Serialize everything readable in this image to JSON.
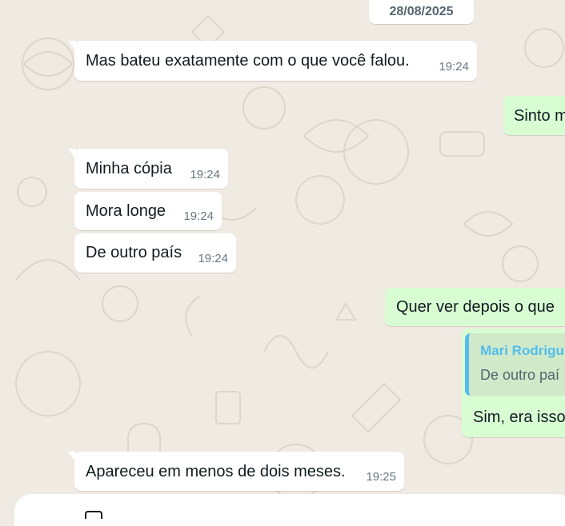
{
  "chat": {
    "date": "28/08/2025",
    "messages": [
      {
        "direction": "in",
        "text": "Mas bateu exatamente com o que você falou.",
        "time": "19:24"
      },
      {
        "direction": "out",
        "text": "Sinto m"
      },
      {
        "direction": "in",
        "text": "Minha cópia",
        "time": "19:24"
      },
      {
        "direction": "in",
        "text": "Mora longe",
        "time": "19:24"
      },
      {
        "direction": "in",
        "text": "De outro país",
        "time": "19:24"
      },
      {
        "direction": "out",
        "text": "Quer ver depois o que"
      },
      {
        "direction": "out",
        "quote_author": "Mari Rodrigu",
        "quote_text": "De outro paí",
        "text": "Sim, era isso"
      },
      {
        "direction": "in",
        "text": "Apareceu em menos de dois meses.",
        "time": "19:25"
      }
    ]
  },
  "colors": {
    "background": "#efeae2",
    "incoming_bubble": "#ffffff",
    "outgoing_bubble": "#d9fdd3",
    "quote_accent": "#53bdeb"
  },
  "composer": {
    "icon": "emoji-icon"
  }
}
